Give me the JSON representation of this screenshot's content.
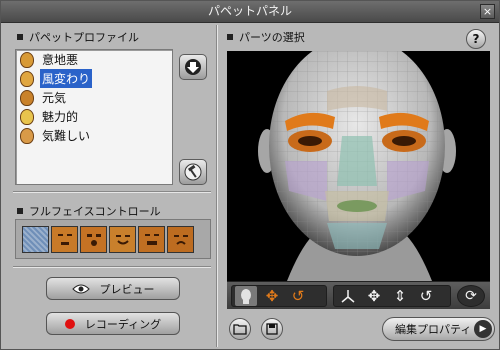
{
  "window": {
    "title": "パペットパネル",
    "close_glyph": "×"
  },
  "left": {
    "profile_section_label": "パペットプロファイル",
    "profiles": [
      {
        "label": "意地悪",
        "selected": false,
        "face_color": "#d89a36"
      },
      {
        "label": "風変わり",
        "selected": true,
        "face_color": "#e0a640"
      },
      {
        "label": "元気",
        "selected": false,
        "face_color": "#c9822b"
      },
      {
        "label": "魅力的",
        "selected": false,
        "face_color": "#e8c44d"
      },
      {
        "label": "気難しい",
        "selected": false,
        "face_color": "#d99a48"
      }
    ],
    "fullface_section_label": "フルフェイスコントロール",
    "fullface_thumbs": [
      {
        "icon": "neutral-face-icon",
        "color": "#6f8fb8"
      },
      {
        "icon": "angry-face-icon",
        "color": "#c87a28"
      },
      {
        "icon": "surprised-face-icon",
        "color": "#c57224"
      },
      {
        "icon": "smile-face-icon",
        "color": "#c9802c"
      },
      {
        "icon": "laugh-face-icon",
        "color": "#c06f22"
      },
      {
        "icon": "frown-face-icon",
        "color": "#bd6c20"
      }
    ],
    "preview_button": "プレビュー",
    "record_button": "レコーディング"
  },
  "right": {
    "parts_section_label": "パーツの選択",
    "help_glyph": "?",
    "edit_properties_button": "編集プロパティ",
    "edit_arrow_glyph": "▶"
  },
  "toolbar": {
    "icons": [
      "head-icon",
      "rotate-3d-icon",
      "undo-orange-icon",
      "axis-icon",
      "move-icon",
      "vertical-move-icon",
      "rotate-icon",
      "reset-icon"
    ]
  },
  "colors": {
    "selection": "#2a62c9",
    "record_dot": "#e01010",
    "accent_orange": "#e07a1a"
  }
}
